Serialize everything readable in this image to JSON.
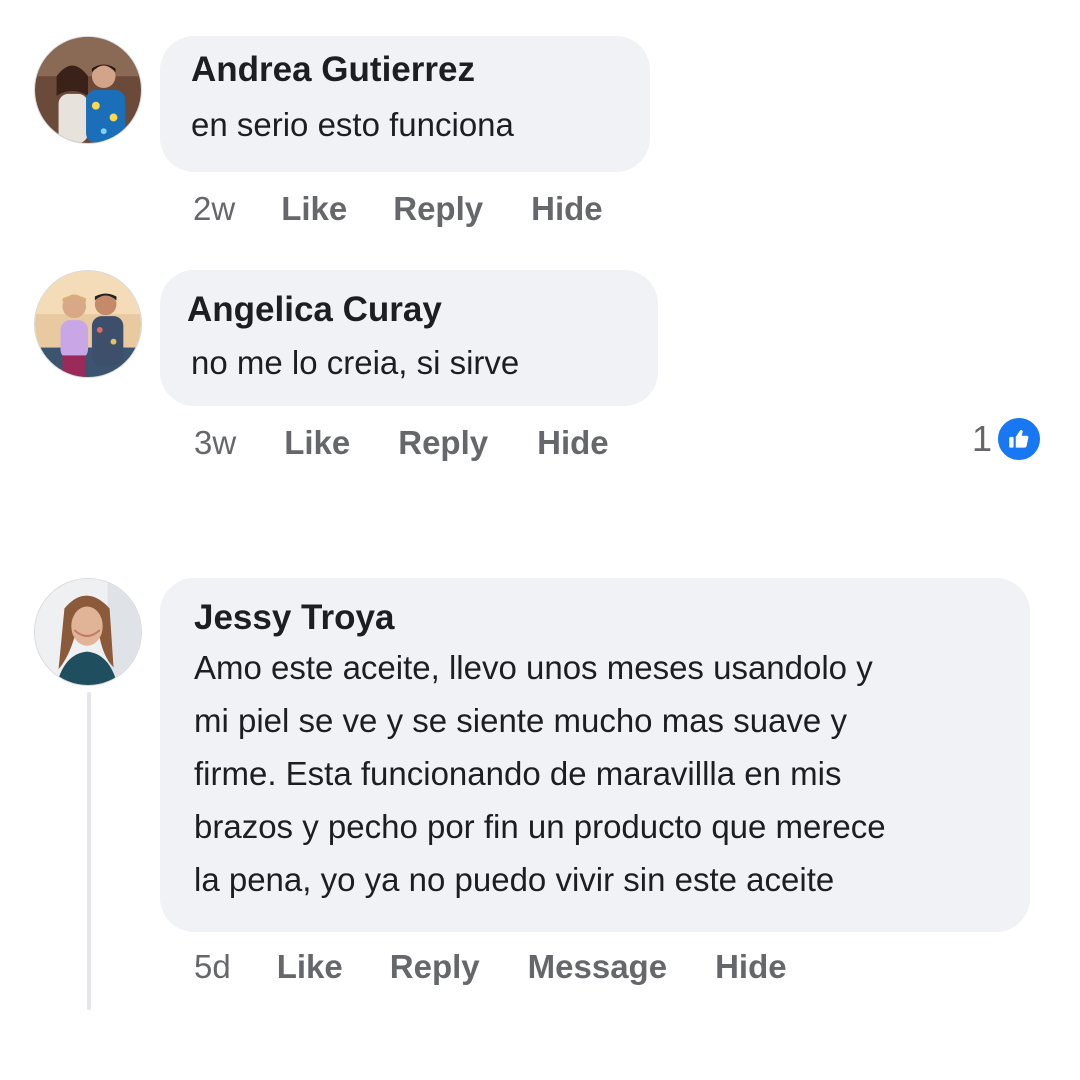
{
  "comments": [
    {
      "author": "Andrea Gutierrez",
      "text": "en serio esto funciona",
      "time": "2w",
      "actions": [
        "Like",
        "Reply",
        "Hide"
      ]
    },
    {
      "author": "Angelica Curay",
      "text": "no me lo creia, si sirve",
      "time": "3w",
      "actions": [
        "Like",
        "Reply",
        "Hide"
      ],
      "reaction_count": "1",
      "reaction_icon": "thumbs-up-icon",
      "reaction_color": "#1877f2"
    },
    {
      "author": "Jessy Troya",
      "text_lines": [
        "Amo este aceite, llevo unos meses usandolo y",
        "mi piel se ve y se siente mucho mas suave y",
        "firme. Esta funcionando de maravillla en mis",
        "brazos y pecho por fin un producto que merece",
        "la pena, yo ya no puedo vivir sin este aceite"
      ],
      "time": "5d",
      "actions": [
        "Like",
        "Reply",
        "Message",
        "Hide"
      ]
    }
  ],
  "colors": {
    "bubble": "#f0f2f5",
    "secondary_text": "#65676b",
    "primary_text": "#1c1e21",
    "like_blue": "#1877f2"
  }
}
